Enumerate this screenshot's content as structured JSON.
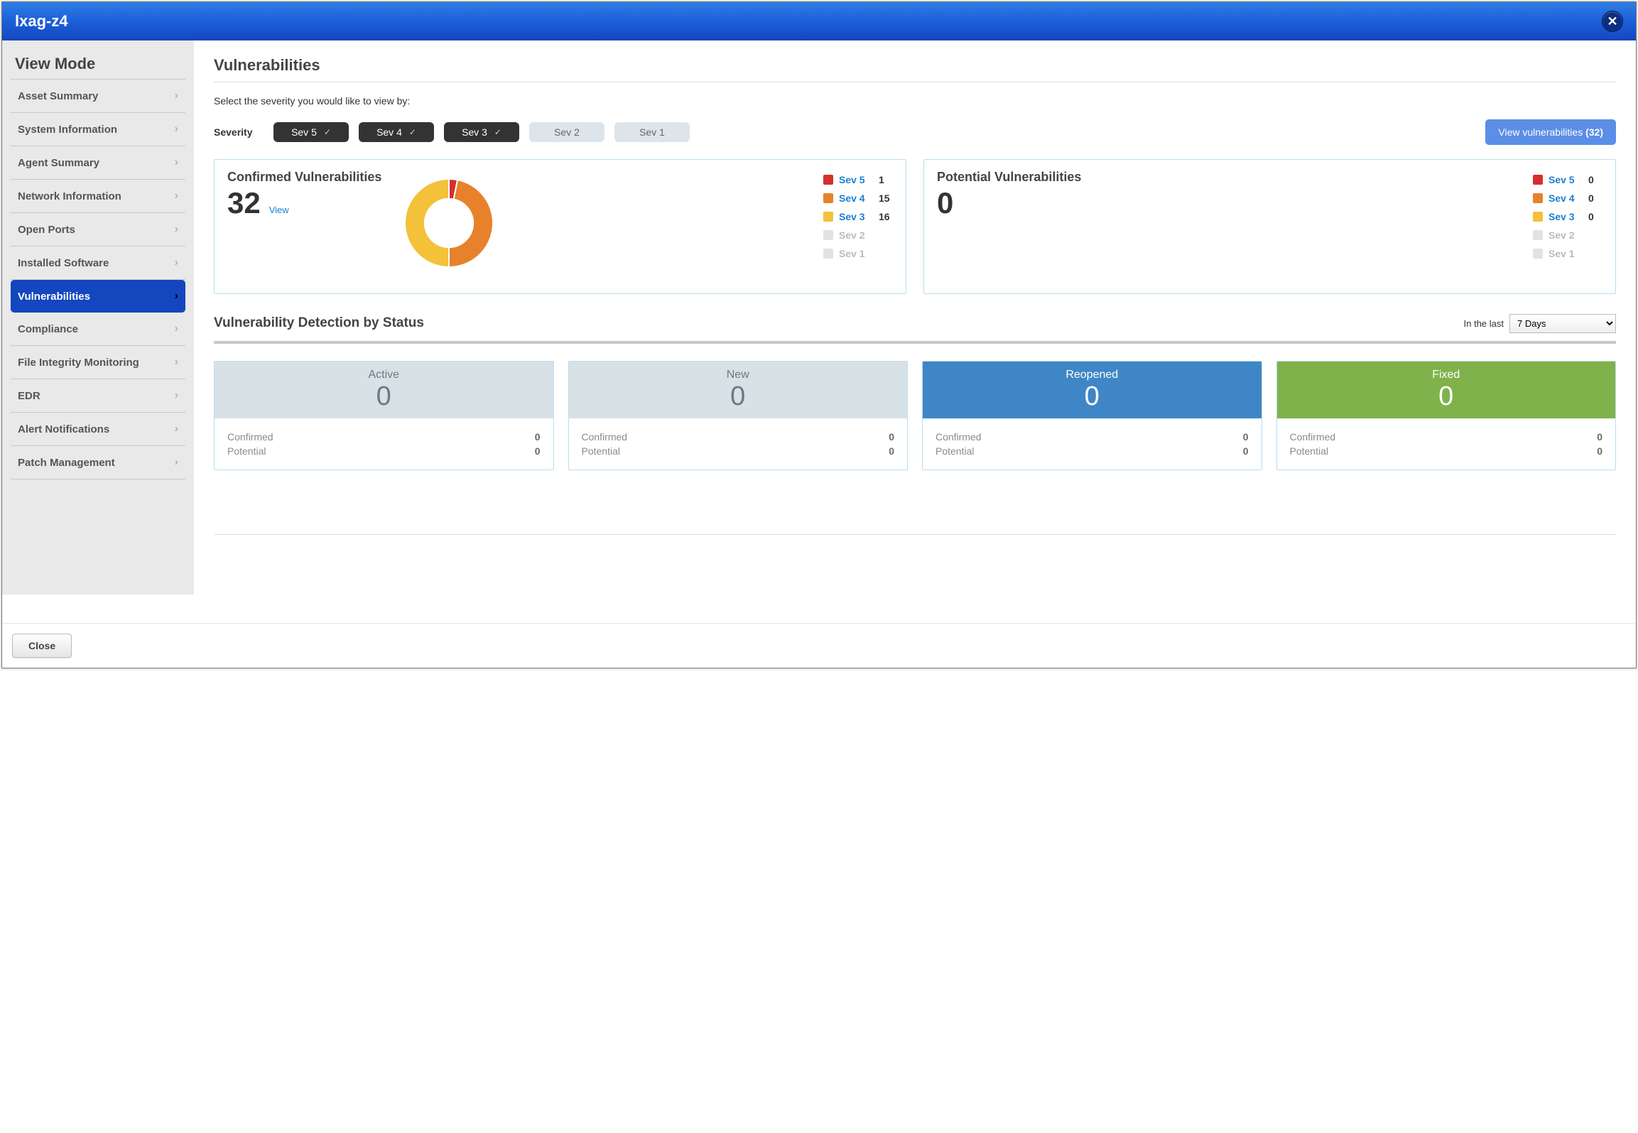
{
  "window": {
    "title": "lxag-z4"
  },
  "sidebar": {
    "heading": "View Mode",
    "items": [
      {
        "label": "Asset Summary",
        "active": false
      },
      {
        "label": "System Information",
        "active": false
      },
      {
        "label": "Agent Summary",
        "active": false
      },
      {
        "label": "Network Information",
        "active": false
      },
      {
        "label": "Open Ports",
        "active": false
      },
      {
        "label": "Installed Software",
        "active": false
      },
      {
        "label": "Vulnerabilities",
        "active": true
      },
      {
        "label": "Compliance",
        "active": false
      },
      {
        "label": "File Integrity Monitoring",
        "active": false
      },
      {
        "label": "EDR",
        "active": false
      },
      {
        "label": "Alert Notifications",
        "active": false
      },
      {
        "label": "Patch Management",
        "active": false
      }
    ]
  },
  "main": {
    "title": "Vulnerabilities",
    "subtext": "Select the severity you would like to view by:",
    "severity_label": "Severity",
    "severity_pills": [
      {
        "label": "Sev 5",
        "selected": true
      },
      {
        "label": "Sev 4",
        "selected": true
      },
      {
        "label": "Sev 3",
        "selected": true
      },
      {
        "label": "Sev 2",
        "selected": false
      },
      {
        "label": "Sev 1",
        "selected": false
      }
    ],
    "view_vulns": {
      "label": "View vulnerabilities",
      "count": "(32)"
    },
    "confirmed": {
      "title": "Confirmed Vulnerabilities",
      "total": "32",
      "view_label": "View",
      "legend": [
        {
          "name": "Sev 5",
          "value": "1",
          "color": "#d62f2f",
          "enabled": true
        },
        {
          "name": "Sev 4",
          "value": "15",
          "color": "#e8812b",
          "enabled": true
        },
        {
          "name": "Sev 3",
          "value": "16",
          "color": "#f4c13a",
          "enabled": true
        },
        {
          "name": "Sev 2",
          "value": "",
          "color": "#e2e2e2",
          "enabled": false
        },
        {
          "name": "Sev 1",
          "value": "",
          "color": "#e2e2e2",
          "enabled": false
        }
      ]
    },
    "potential": {
      "title": "Potential Vulnerabilities",
      "total": "0",
      "legend": [
        {
          "name": "Sev 5",
          "value": "0",
          "color": "#d62f2f",
          "enabled": true
        },
        {
          "name": "Sev 4",
          "value": "0",
          "color": "#e8812b",
          "enabled": true
        },
        {
          "name": "Sev 3",
          "value": "0",
          "color": "#f4c13a",
          "enabled": true
        },
        {
          "name": "Sev 2",
          "value": "",
          "color": "#e2e2e2",
          "enabled": false
        },
        {
          "name": "Sev 1",
          "value": "",
          "color": "#e2e2e2",
          "enabled": false
        }
      ]
    },
    "detection": {
      "title": "Vulnerability Detection by Status",
      "in_last_label": "In the last",
      "range_selected": "7 Days",
      "cards": [
        {
          "name": "Active",
          "count": "0",
          "color": "grey",
          "confirmed": "0",
          "potential": "0"
        },
        {
          "name": "New",
          "count": "0",
          "color": "grey",
          "confirmed": "0",
          "potential": "0"
        },
        {
          "name": "Reopened",
          "count": "0",
          "color": "blue",
          "confirmed": "0",
          "potential": "0"
        },
        {
          "name": "Fixed",
          "count": "0",
          "color": "green",
          "confirmed": "0",
          "potential": "0"
        }
      ],
      "row_labels": {
        "confirmed": "Confirmed",
        "potential": "Potential"
      }
    }
  },
  "footer": {
    "close_label": "Close"
  },
  "chart_data": {
    "type": "pie",
    "title": "Confirmed Vulnerabilities",
    "series": [
      {
        "name": "Sev 5",
        "value": 1,
        "color": "#d62f2f"
      },
      {
        "name": "Sev 4",
        "value": 15,
        "color": "#e8812b"
      },
      {
        "name": "Sev 3",
        "value": 16,
        "color": "#f4c13a"
      }
    ],
    "total": 32,
    "inner_radius_ratio": 0.55
  }
}
